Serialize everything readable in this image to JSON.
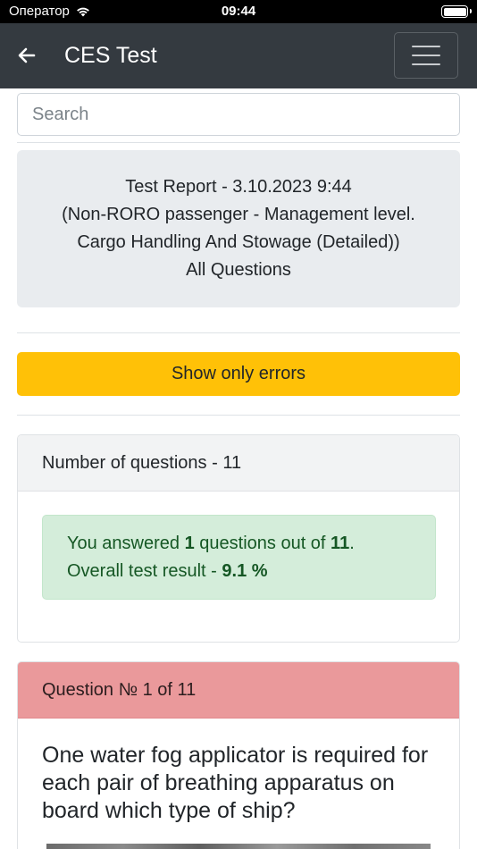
{
  "status_bar": {
    "carrier": "Оператор",
    "time": "09:44"
  },
  "navbar": {
    "title": "CES Test"
  },
  "search": {
    "placeholder": "Search"
  },
  "report": {
    "lines": [
      "Test Report - 3.10.2023 9:44",
      "(Non-RORO passenger - Management level.",
      "Cargo Handling And Stowage (Detailed))",
      "All Questions"
    ]
  },
  "errors_button": {
    "label": "Show only errors"
  },
  "summary": {
    "header": "Number of questions - 11",
    "answered_prefix": "You answered ",
    "answered_count": "1",
    "answered_middle": " questions out of ",
    "total_count": "11",
    "answered_suffix": ".",
    "result_prefix": "Overall test result - ",
    "result_value": "9.1 %"
  },
  "question": {
    "header": "Question № 1 of 11",
    "text": "One water fog applicator is required for each pair of breathing apparatus on board which type of ship?"
  },
  "colors": {
    "navbar": "#343a40",
    "warning": "#ffc107",
    "success_bg": "#d4edda",
    "danger_header": "#ea999b"
  }
}
